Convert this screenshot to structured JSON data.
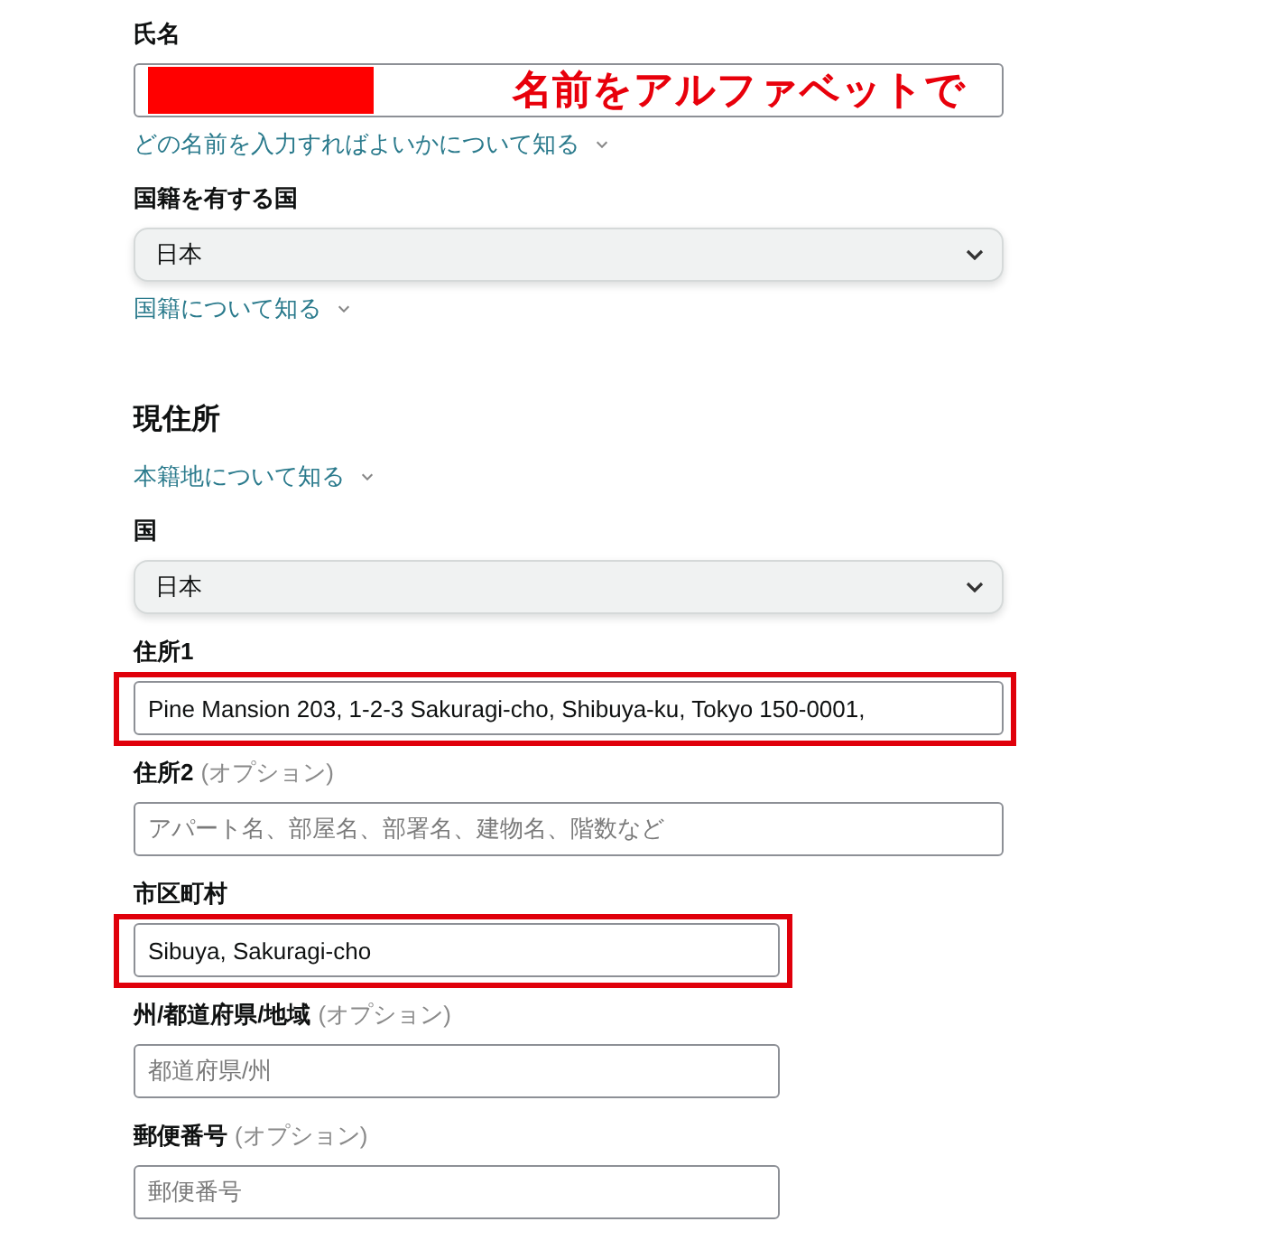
{
  "items": [
    {
      "kind": "field",
      "label": "氏名",
      "redacted": true,
      "annotation": "名前をアルファベットで",
      "highlighted": false
    },
    {
      "kind": "link",
      "text": "どの名前を入力すればよいかについて知る"
    },
    {
      "kind": "select",
      "label": "国籍を有する国",
      "value": "日本"
    },
    {
      "kind": "link",
      "text": "国籍について知る"
    },
    {
      "kind": "heading",
      "text": "現住所"
    },
    {
      "kind": "link",
      "text": "本籍地について知る"
    },
    {
      "kind": "select",
      "label": "国",
      "value": "日本"
    },
    {
      "kind": "field",
      "label": "住所1",
      "value": "Pine Mansion 203, 1-2-3 Sakuragi-cho, Shibuya-ku, Tokyo 150-0001,",
      "highlighted": true
    },
    {
      "kind": "field",
      "label": "住所2",
      "note": "(オプション)",
      "placeholder": "アパート名、部屋名、部署名、建物名、階数など",
      "highlighted": false
    },
    {
      "kind": "short_field",
      "label": "市区町村",
      "value": "Sibuya, Sakuragi-cho",
      "highlighted": true
    },
    {
      "kind": "short_field",
      "label": "州/都道府県/地域",
      "note": "(オプション)",
      "placeholder": "都道府県/州",
      "highlighted": false
    },
    {
      "kind": "short_field",
      "label": "郵便番号",
      "note": "(オプション)",
      "placeholder": "郵便番号",
      "highlighted": false
    }
  ]
}
